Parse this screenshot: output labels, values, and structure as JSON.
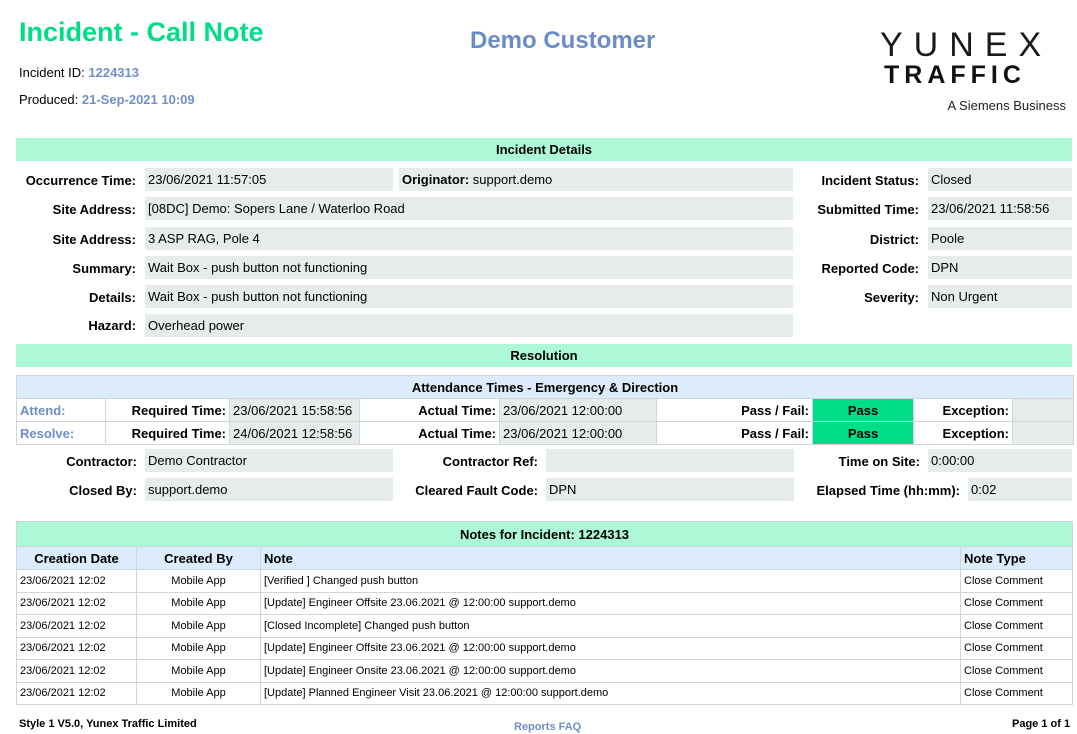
{
  "header": {
    "title": "Incident - Call Note",
    "incident_id_label": "Incident ID:",
    "incident_id": "1224313",
    "produced_label": "Produced:",
    "produced": "21-Sep-2021 10:09",
    "customer": "Demo Customer",
    "logo": {
      "line1": "YUNEX",
      "line2": "TRAFFIC",
      "tagline": "A Siemens Business"
    }
  },
  "incident_details": {
    "title": "Incident Details",
    "occurrence_time_label": "Occurrence Time:",
    "occurrence_time": "23/06/2021 11:57:05",
    "originator_label": "Originator:",
    "originator": "support.demo",
    "site_address_label": "Site Address:",
    "site_address_1": "[08DC] Demo: Sopers Lane / Waterloo Road",
    "site_address_2": "3 ASP RAG, Pole 4",
    "summary_label": "Summary:",
    "summary": "Wait Box - push button not functioning",
    "details_label": "Details:",
    "details": "Wait Box - push button not functioning",
    "hazard_label": "Hazard:",
    "hazard": "Overhead power",
    "status_label": "Incident Status:",
    "status": "Closed",
    "submitted_label": "Submitted Time:",
    "submitted": "23/06/2021 11:58:56",
    "district_label": "District:",
    "district": "Poole",
    "reported_code_label": "Reported Code:",
    "reported_code": "DPN",
    "severity_label": "Severity:",
    "severity": "Non Urgent"
  },
  "resolution": {
    "title": "Resolution",
    "attendance_title": "Attendance Times - Emergency & Direction",
    "rows": [
      {
        "name": "Attend:",
        "required_label": "Required Time:",
        "required": "23/06/2021 15:58:56",
        "actual_label": "Actual Time:",
        "actual": "23/06/2021 12:00:00",
        "pass_label": "Pass / Fail:",
        "pass": "Pass",
        "exception_label": "Exception:",
        "exception": ""
      },
      {
        "name": "Resolve:",
        "required_label": "Required Time:",
        "required": "24/06/2021 12:58:56",
        "actual_label": "Actual Time:",
        "actual": "23/06/2021 12:00:00",
        "pass_label": "Pass / Fail:",
        "pass": "Pass",
        "exception_label": "Exception:",
        "exception": ""
      }
    ],
    "contractor_label": "Contractor:",
    "contractor": "Demo Contractor",
    "contractor_ref_label": "Contractor Ref:",
    "contractor_ref": "",
    "time_on_site_label": "Time on Site:",
    "time_on_site": "0:00:00",
    "closed_by_label": "Closed By:",
    "closed_by": "support.demo",
    "cleared_fault_label": "Cleared Fault Code:",
    "cleared_fault": "DPN",
    "elapsed_label": "Elapsed Time (hh:mm):",
    "elapsed": "0:02"
  },
  "notes": {
    "title_prefix": "Notes for Incident:",
    "incident_id": "1224313",
    "columns": [
      "Creation Date",
      "Created By",
      "Note",
      "Note Type"
    ],
    "rows": [
      [
        "23/06/2021 12:02",
        "Mobile App",
        "[Verified ] Changed push button",
        "Close Comment"
      ],
      [
        "23/06/2021 12:02",
        "Mobile App",
        "[Update] Engineer Offsite 23.06.2021 @ 12:00:00 support.demo",
        "Close Comment"
      ],
      [
        "23/06/2021 12:02",
        "Mobile App",
        "[Closed Incomplete] Changed push button",
        "Close Comment"
      ],
      [
        "23/06/2021 12:02",
        "Mobile App",
        "[Update] Engineer Offsite 23.06.2021 @ 12:00:00 support.demo",
        "Close Comment"
      ],
      [
        "23/06/2021 12:02",
        "Mobile App",
        "[Update] Engineer Onsite 23.06.2021 @ 12:00:00 support.demo",
        "Close Comment"
      ],
      [
        "23/06/2021 12:02",
        "Mobile App",
        "[Update] Planned Engineer Visit 23.06.2021 @ 12:00:00 support.demo",
        "Close Comment"
      ]
    ]
  },
  "footer": {
    "left": "Style 1 V5.0, Yunex Traffic Limited",
    "center_link": "Reports FAQ",
    "right": "Page 1 of 1"
  },
  "colors": {
    "title_green": "#00dd88",
    "accent_blue": "#6f8fc8",
    "band_green": "#adf8d6",
    "header_blue": "#dcecfc",
    "field_grey": "#e6ecec",
    "pass_green": "#00dd88"
  }
}
